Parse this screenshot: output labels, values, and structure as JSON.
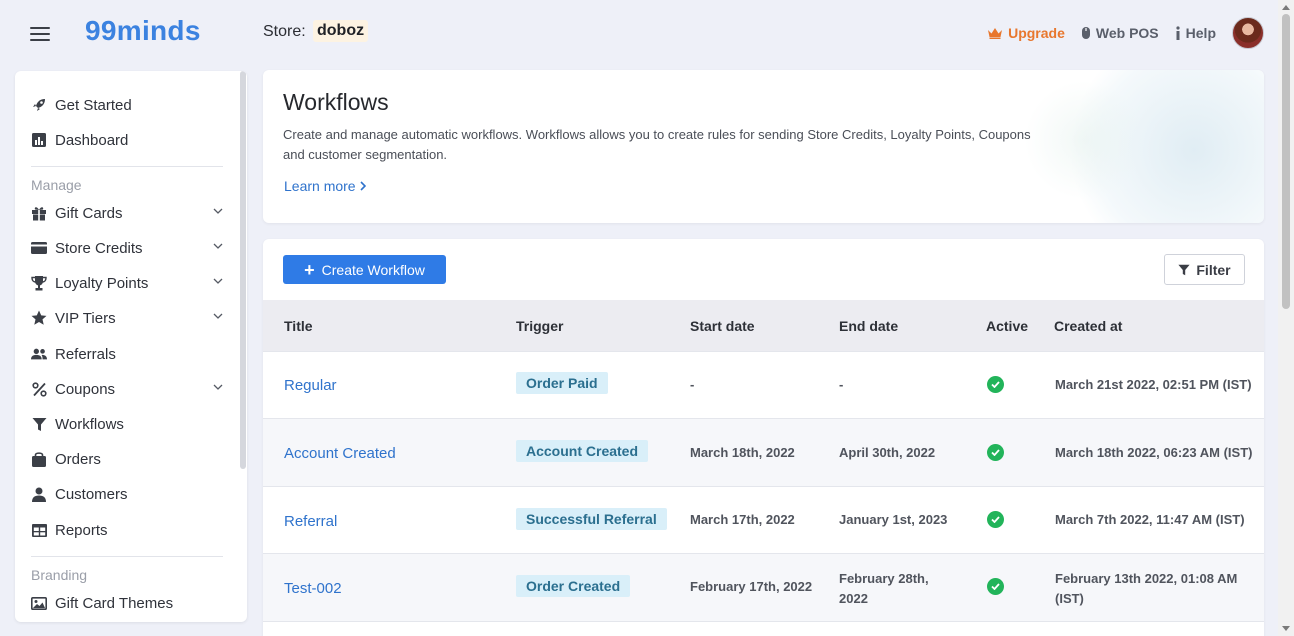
{
  "header": {
    "logo": "99minds",
    "store_label": "Store:",
    "store_name": "doboz",
    "upgrade": "Upgrade",
    "web_pos": "Web POS",
    "help": "Help"
  },
  "sidebar": {
    "top_items": [
      {
        "label": "Get Started",
        "icon": "rocket-icon"
      },
      {
        "label": "Dashboard",
        "icon": "chart-icon"
      }
    ],
    "manage_label": "Manage",
    "manage_items": [
      {
        "label": "Gift Cards",
        "icon": "gift-icon",
        "expandable": true
      },
      {
        "label": "Store Credits",
        "icon": "wallet-icon",
        "expandable": true
      },
      {
        "label": "Loyalty Points",
        "icon": "trophy-icon",
        "expandable": true
      },
      {
        "label": "VIP Tiers",
        "icon": "star-icon",
        "expandable": true
      },
      {
        "label": "Referrals",
        "icon": "users-icon",
        "expandable": false
      },
      {
        "label": "Coupons",
        "icon": "percent-icon",
        "expandable": true
      },
      {
        "label": "Workflows",
        "icon": "funnel-icon",
        "expandable": false
      },
      {
        "label": "Orders",
        "icon": "bag-icon",
        "expandable": false
      },
      {
        "label": "Customers",
        "icon": "user-icon",
        "expandable": false
      },
      {
        "label": "Reports",
        "icon": "table-icon",
        "expandable": false
      }
    ],
    "branding_label": "Branding",
    "branding_items": [
      {
        "label": "Gift Card Themes",
        "icon": "image-icon"
      }
    ]
  },
  "main": {
    "title": "Workflows",
    "description": "Create and manage automatic workflows. Workflows allows you to create rules for sending Store Credits, Loyalty Points, Coupons and customer segmentation.",
    "learn_more": "Learn more",
    "create_button": "Create Workflow",
    "filter_button": "Filter",
    "table": {
      "columns": [
        "Title",
        "Trigger",
        "Start date",
        "End date",
        "Active",
        "Created at"
      ],
      "rows": [
        {
          "title": "Regular",
          "trigger": "Order Paid",
          "start": "-",
          "end": "-",
          "active": true,
          "created": "March 21st 2022, 02:51 PM (IST)"
        },
        {
          "title": "Account Created",
          "trigger": "Account Created",
          "start": "March 18th, 2022",
          "end": "April 30th, 2022",
          "active": true,
          "created": "March 18th 2022, 06:23 AM (IST)"
        },
        {
          "title": "Referral",
          "trigger": "Successful Referral",
          "start": "March 17th, 2022",
          "end": "January 1st, 2023",
          "active": true,
          "created": "March 7th 2022, 11:47 AM (IST)"
        },
        {
          "title": "Test-002",
          "trigger": "Order Created",
          "start": "February 17th, 2022",
          "end": "February 28th, 2022",
          "active": true,
          "created": "February 13th 2022, 01:08 AM (IST)"
        }
      ]
    }
  },
  "colors": {
    "brand": "#3b82e0",
    "primary_button": "#2f7be6",
    "upgrade": "#e8772e",
    "active_check": "#22b45a",
    "badge_bg": "#d9eff9"
  }
}
